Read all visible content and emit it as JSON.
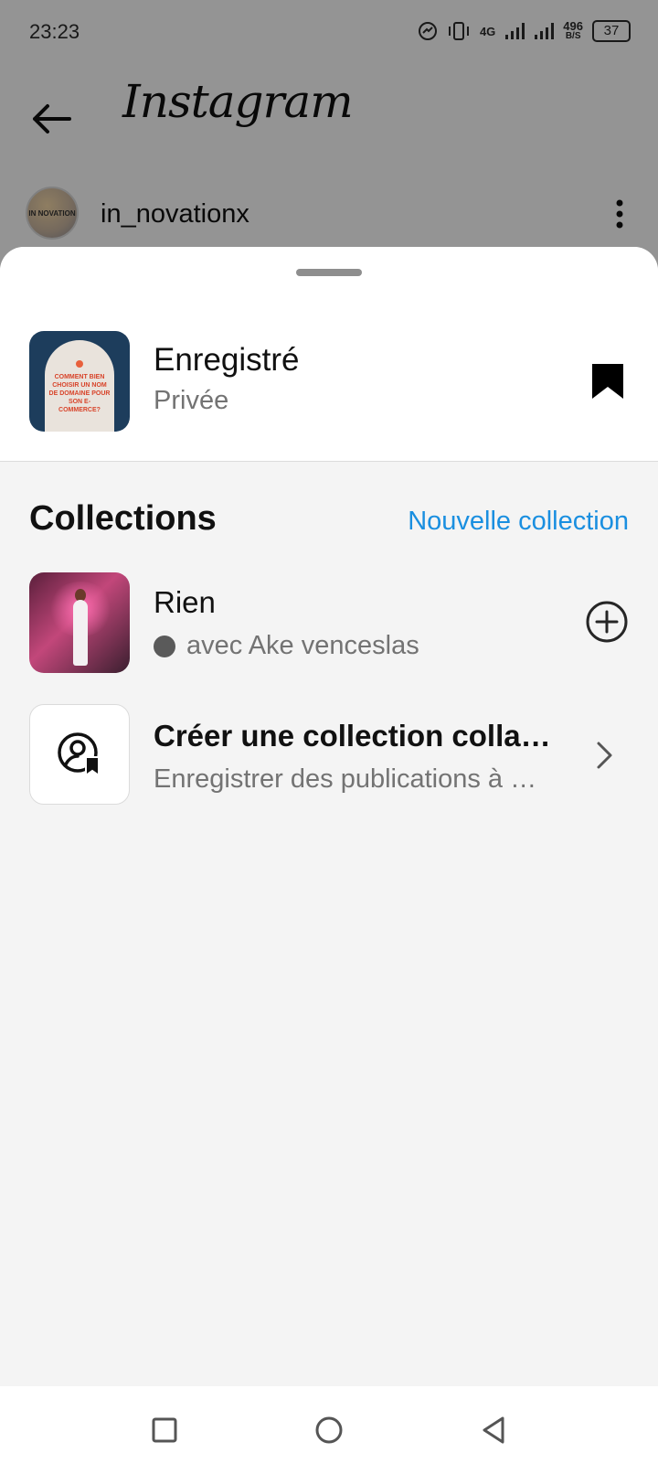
{
  "status_bar": {
    "time": "23:23",
    "network": "4G",
    "speed_value": "496",
    "speed_unit": "B/S",
    "battery": "37"
  },
  "header": {
    "app_name": "Instagram"
  },
  "post": {
    "username": "in_novationx",
    "avatar_text": "IN NOVATION"
  },
  "sheet": {
    "saved": {
      "title": "Enregistré",
      "subtitle": "Privée",
      "thumbnail_text": "COMMENT BIEN CHOISIR UN NOM DE DOMAINE POUR SON E-COMMERCE?"
    },
    "collections_heading": "Collections",
    "new_collection_label": "Nouvelle collection",
    "items": [
      {
        "title": "Rien",
        "subtitle": "avec Ake venceslas"
      },
      {
        "title": "Créer une collection colla…",
        "subtitle": "Enregistrer des publications à …"
      }
    ]
  },
  "colors": {
    "accent": "#1a8fe0",
    "secondary_text": "#737373",
    "sheet_bg": "#f4f4f4"
  },
  "icons": {
    "back": "arrow-left-icon",
    "more": "more-vertical-icon",
    "bookmark": "bookmark-filled-icon",
    "add": "plus-circle-icon",
    "collab": "user-bookmark-icon",
    "chevron": "chevron-right-icon",
    "nav_recents": "square-icon",
    "nav_home": "circle-icon",
    "nav_back": "triangle-back-icon"
  }
}
